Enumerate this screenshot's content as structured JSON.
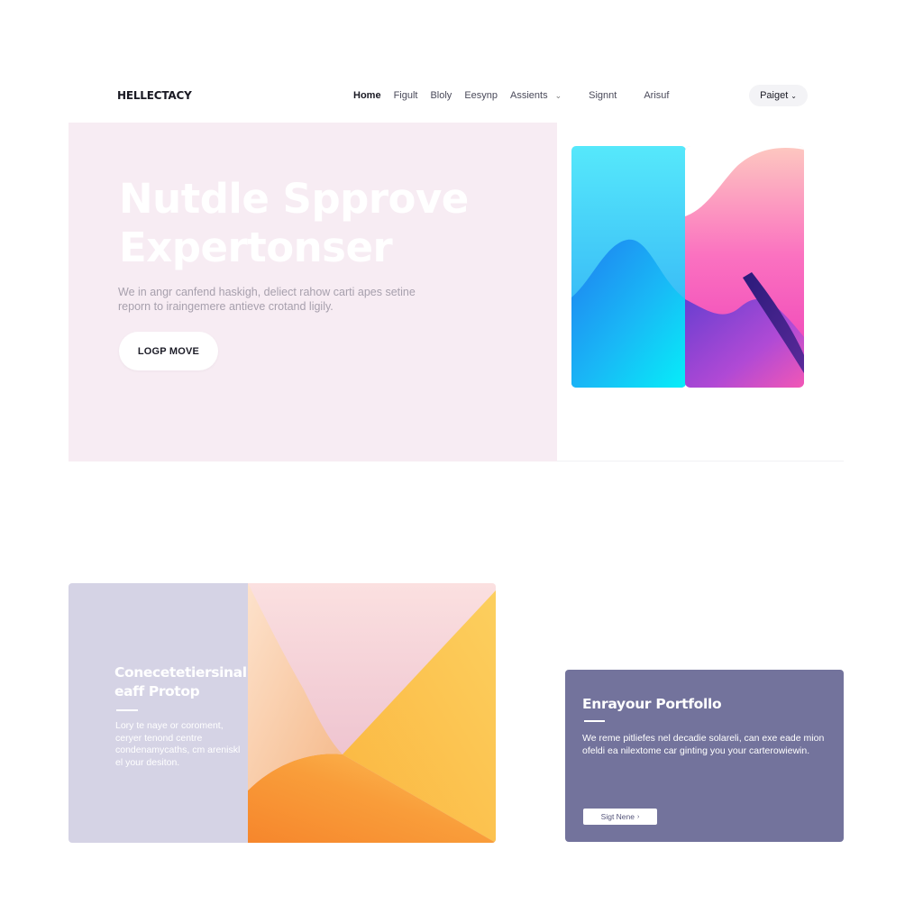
{
  "nav": {
    "logo": "HELLECTACY",
    "links": [
      {
        "label": "Home",
        "active": true
      },
      {
        "label": "Figult"
      },
      {
        "label": "Bloly"
      },
      {
        "label": "Eesynp"
      },
      {
        "label": "Assients",
        "has_dropdown": true
      },
      {
        "label": "Signnt"
      },
      {
        "label": "Arisuf"
      }
    ],
    "cta": {
      "label": "Paiget",
      "icon": "chevron-down-icon"
    }
  },
  "hero": {
    "title_line1": "Nutdle Spprove",
    "title_line2": "Expertonser",
    "description": "We in angr canfend haskigh, deliect rahow carti apes setine reporn to iraingemere antieve crotand ligily.",
    "button_label": "LOGP MOVE",
    "background_color": "#f7ecf3"
  },
  "card1": {
    "title": "Conecetetiersinal eaff Protop",
    "description": "Lory te naye or coroment, ceryer tenond centre condenamycaths, cm areniskl el your desiton.",
    "panel_color": "#d5d3e5"
  },
  "card2": {
    "title": "Enrayour Portfollo",
    "description": "We reme pitliefes nel decadie solareli, can exe eade mion ofeldi ea nilextome car ginting you your carterowiewin.",
    "button_label": "Sigt Nene",
    "button_icon": "chevron-right-icon",
    "panel_color": "#73739c"
  }
}
